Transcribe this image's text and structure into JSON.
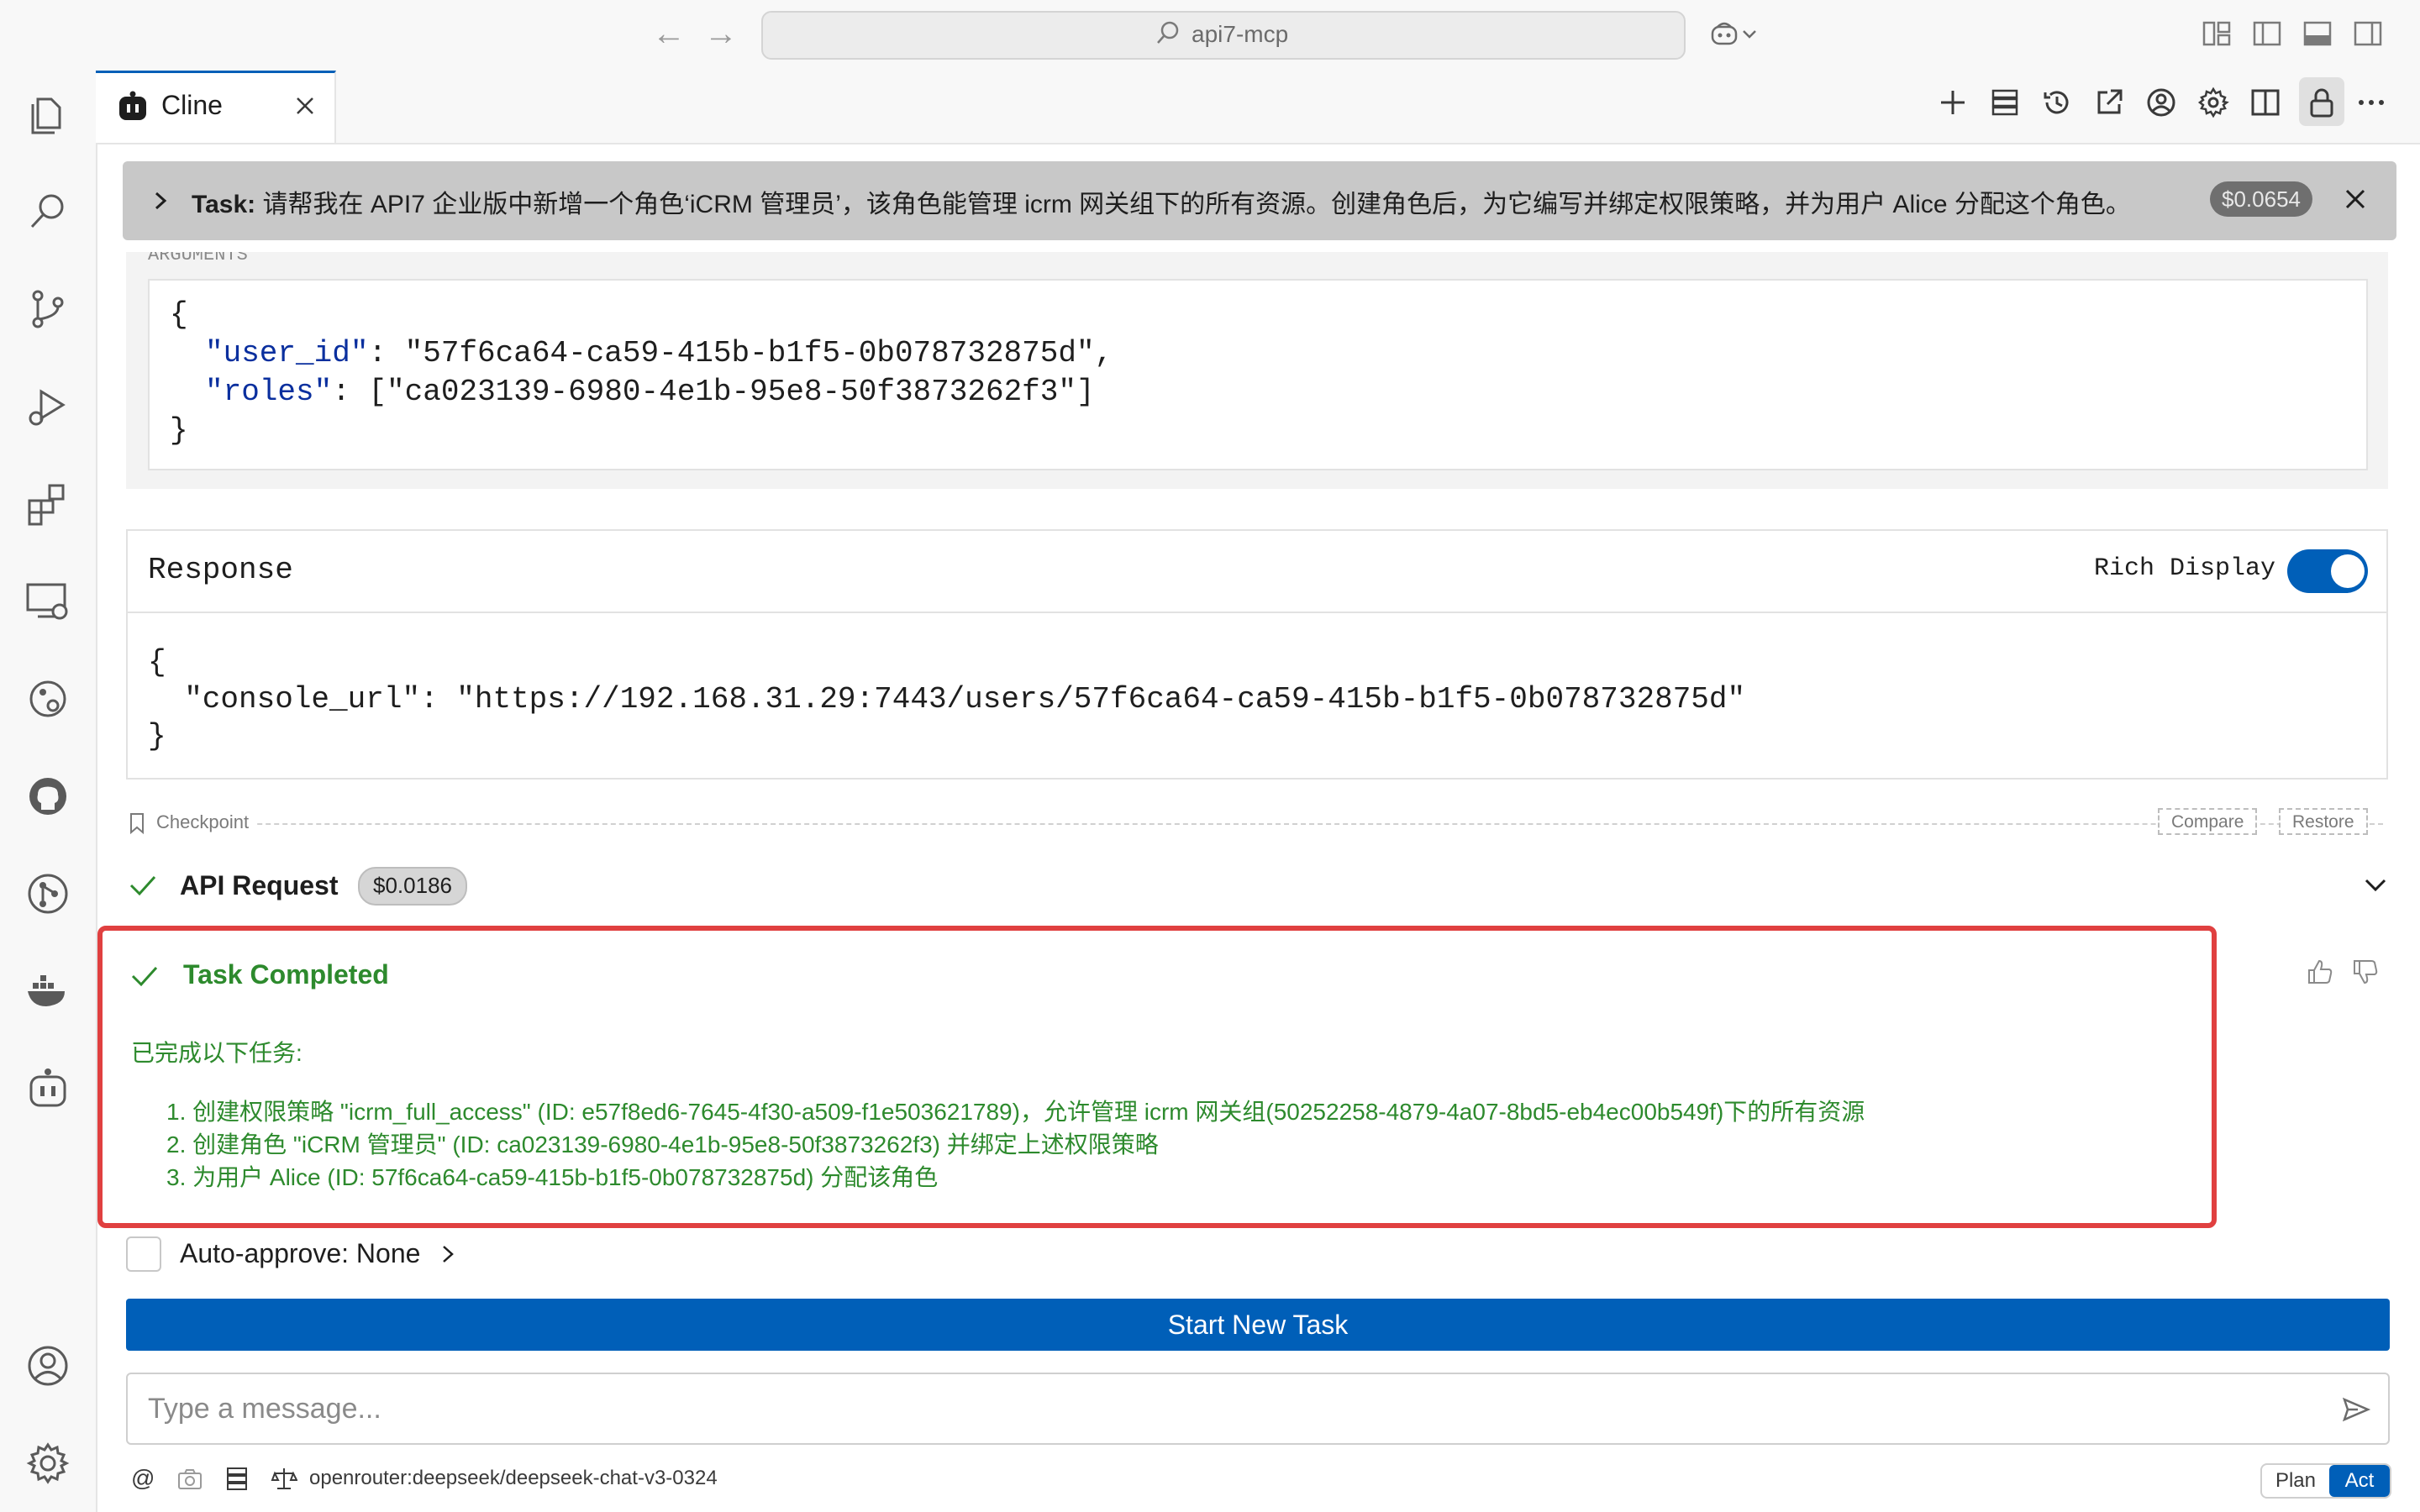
{
  "titlebar": {
    "search_text": "api7-mcp",
    "back_glyph": "←",
    "forward_glyph": "→"
  },
  "tab": {
    "label": "Cline"
  },
  "task": {
    "prefix": "Task:",
    "text": "请帮我在 API7 企业版中新增一个角色‘iCRM 管理员’，该角色能管理 icrm 网关组下的所有资源。创建角色后，为它编写并绑定权限策略，并为用户 Alice 分配这个角色。",
    "cost": "$0.0654"
  },
  "arguments": {
    "header_fragment": "ARGUMENTS",
    "line1": "{",
    "key1": "\"user_id\"",
    "val1": ": \"57f6ca64-ca59-415b-b1f5-0b078732875d\",",
    "key2": "\"roles\"",
    "val2": ": [\"ca023139-6980-4e1b-95e8-50f3873262f3\"]",
    "line_end": "}"
  },
  "response": {
    "title": "Response",
    "rich_display_label": "Rich Display",
    "rich_display_on": true,
    "line1": "{",
    "line2": "  \"console_url\": \"https://192.168.31.29:7443/users/57f6ca64-ca59-415b-b1f5-0b078732875d\"",
    "line3": "}"
  },
  "checkpoint": {
    "label": "Checkpoint",
    "compare": "Compare",
    "restore": "Restore"
  },
  "api_request": {
    "label": "API Request",
    "cost": "$0.0186"
  },
  "task_completed": {
    "title": "Task Completed",
    "intro": "已完成以下任务:",
    "items": [
      "1. 创建权限策略 \"icrm_full_access\" (ID: e57f8ed6-7645-4f30-a509-f1e503621789)，允许管理 icrm 网关组(50252258-4879-4a07-8bd5-eb4ec00b549f)下的所有资源",
      "2. 创建角色 \"iCRM 管理员\" (ID: ca023139-6980-4e1b-95e8-50f3873262f3) 并绑定上述权限策略",
      "3. 为用户 Alice (ID: 57f6ca64-ca59-415b-b1f5-0b078732875d) 分配该角色"
    ]
  },
  "auto_approve": {
    "label": "Auto-approve: None"
  },
  "start_new_task": "Start New Task",
  "message_input": {
    "placeholder": "Type a message..."
  },
  "bottom": {
    "at_glyph": "@",
    "model": "openrouter:deepseek/deepseek-chat-v3-0324",
    "plan": "Plan",
    "act": "Act"
  },
  "colors": {
    "accent": "#005fb8",
    "success": "#2d8a2d",
    "highlight_border": "#e04040"
  }
}
